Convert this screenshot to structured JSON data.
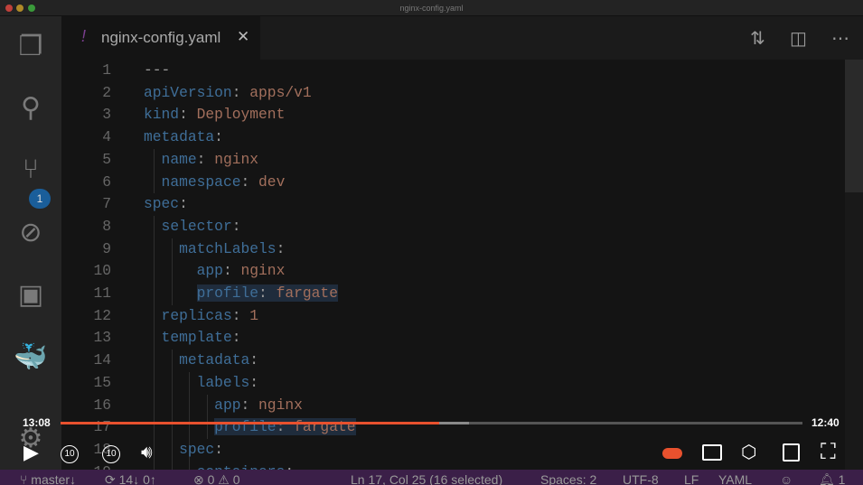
{
  "window": {
    "title": "nginx-config.yaml"
  },
  "tab": {
    "icon": "exclamation-icon",
    "label": "nginx-config.yaml",
    "close": "✕"
  },
  "activity_bar": {
    "items": [
      "explorer-icon",
      "search-icon",
      "source-control-icon",
      "debug-icon",
      "extensions-icon",
      "docker-icon",
      "settings-gear-icon"
    ],
    "scm_badge": "1"
  },
  "editor": {
    "lines": [
      [
        [
          "p",
          "---"
        ]
      ],
      [
        [
          "k",
          "apiVersion"
        ],
        [
          "p",
          ": "
        ],
        [
          "v",
          "apps/v1"
        ]
      ],
      [
        [
          "k",
          "kind"
        ],
        [
          "p",
          ": "
        ],
        [
          "v",
          "Deployment"
        ]
      ],
      [
        [
          "k",
          "metadata"
        ],
        [
          "p",
          ":"
        ]
      ],
      [
        [
          "p",
          "  "
        ],
        [
          "k",
          "name"
        ],
        [
          "p",
          ": "
        ],
        [
          "v",
          "nginx"
        ]
      ],
      [
        [
          "p",
          "  "
        ],
        [
          "k",
          "namespace"
        ],
        [
          "p",
          ": "
        ],
        [
          "v",
          "dev"
        ]
      ],
      [
        [
          "k",
          "spec"
        ],
        [
          "p",
          ":"
        ]
      ],
      [
        [
          "p",
          "  "
        ],
        [
          "k",
          "selector"
        ],
        [
          "p",
          ":"
        ]
      ],
      [
        [
          "p",
          "    "
        ],
        [
          "k",
          "matchLabels"
        ],
        [
          "p",
          ":"
        ]
      ],
      [
        [
          "p",
          "      "
        ],
        [
          "k",
          "app"
        ],
        [
          "p",
          ": "
        ],
        [
          "v",
          "nginx"
        ]
      ],
      [
        [
          "p",
          "      "
        ],
        [
          "k",
          "profile"
        ],
        [
          "p",
          ": "
        ],
        [
          "v",
          "fargate"
        ]
      ],
      [
        [
          "p",
          "  "
        ],
        [
          "k",
          "replicas"
        ],
        [
          "p",
          ": "
        ],
        [
          "v",
          "1"
        ]
      ],
      [
        [
          "p",
          "  "
        ],
        [
          "k",
          "template"
        ],
        [
          "p",
          ":"
        ]
      ],
      [
        [
          "p",
          "    "
        ],
        [
          "k",
          "metadata"
        ],
        [
          "p",
          ":"
        ]
      ],
      [
        [
          "p",
          "      "
        ],
        [
          "k",
          "labels"
        ],
        [
          "p",
          ":"
        ]
      ],
      [
        [
          "p",
          "        "
        ],
        [
          "k",
          "app"
        ],
        [
          "p",
          ": "
        ],
        [
          "v",
          "nginx"
        ]
      ],
      [
        [
          "p",
          "        "
        ],
        [
          "k",
          "profile"
        ],
        [
          "p",
          ": "
        ],
        [
          "v",
          "fargate"
        ]
      ],
      [
        [
          "p",
          "    "
        ],
        [
          "k",
          "spec"
        ],
        [
          "p",
          ":"
        ]
      ],
      [
        [
          "p",
          "      "
        ],
        [
          "k",
          "containers"
        ],
        [
          "p",
          ":"
        ]
      ]
    ]
  },
  "video": {
    "elapsed": "13:08",
    "remaining": "12:40",
    "played_fraction": 0.51,
    "buffered_fraction": 0.55,
    "accent": "#e8512e",
    "skip_back": "10",
    "skip_forward": "10"
  },
  "statusbar": {
    "branch": "master↓",
    "sync": "14↓ 0↑",
    "errors": "0",
    "warnings": "0",
    "position": "Ln 17, Col 25 (16 selected)",
    "spaces": "Spaces: 2",
    "encoding": "UTF-8",
    "eol": "LF",
    "language": "YAML",
    "notifications": "1"
  }
}
